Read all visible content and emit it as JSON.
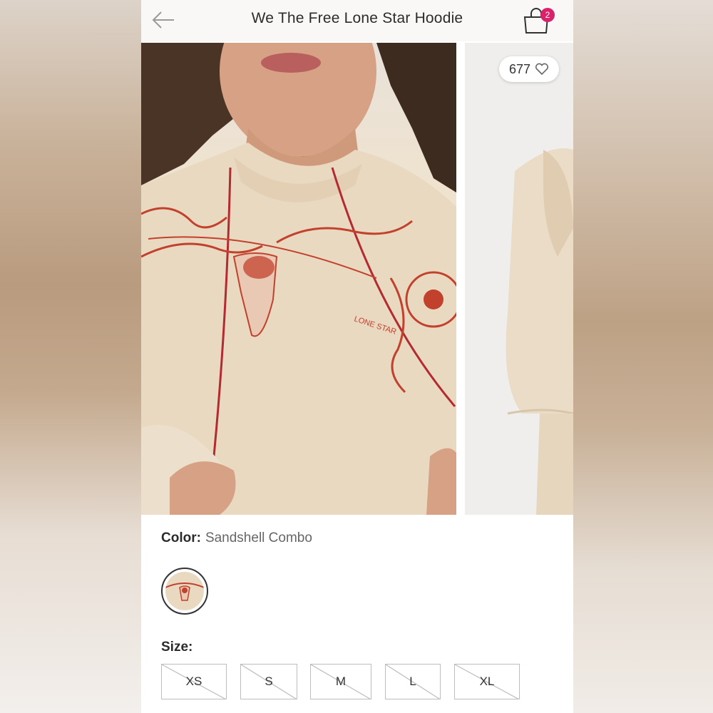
{
  "header": {
    "title": "We The Free Lone Star Hoodie",
    "cart_count": "2",
    "back_icon": "arrow-left-icon",
    "cart_icon": "shopping-bag-icon"
  },
  "gallery": {
    "like_count": "677",
    "like_icon": "heart-outline-icon",
    "print_text": "LONE STAR"
  },
  "product": {
    "color_label": "Color:",
    "color_value": "Sandshell Combo",
    "size_label": "Size:",
    "sizes": [
      "XS",
      "S",
      "M",
      "L",
      "XL"
    ]
  },
  "colors": {
    "badge": "#d8226a",
    "hoodie": "#ead9c1",
    "print": "#c2412d"
  }
}
